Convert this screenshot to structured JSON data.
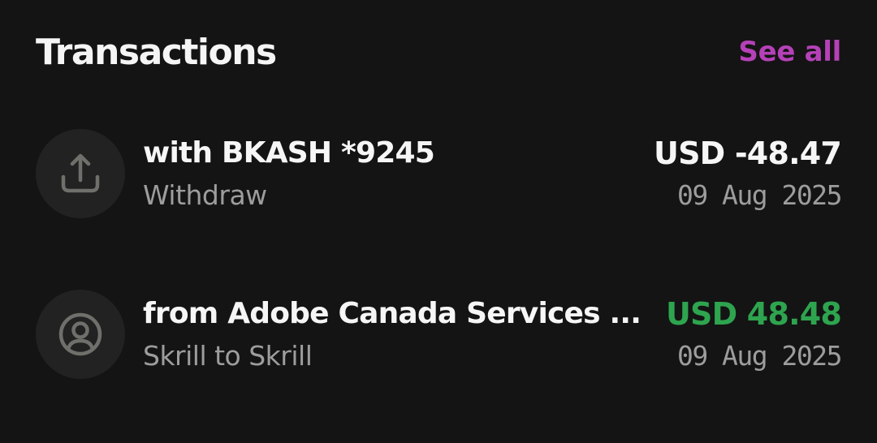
{
  "header": {
    "title": "Transactions",
    "see_all_label": "See all",
    "accent_color": "#b541b8"
  },
  "transactions": [
    {
      "icon": "upload-icon",
      "name": "with BKASH *9245",
      "type": "Withdraw",
      "amount": "USD -48.47",
      "date": "09 Aug 2025",
      "amount_color": "#f6f6f6"
    },
    {
      "icon": "user-circle-icon",
      "name": "from Adobe Canada Services ...",
      "type": "Skrill to Skrill",
      "amount": "USD 48.48",
      "date": "09 Aug 2025",
      "amount_color": "#2ea44f"
    }
  ]
}
